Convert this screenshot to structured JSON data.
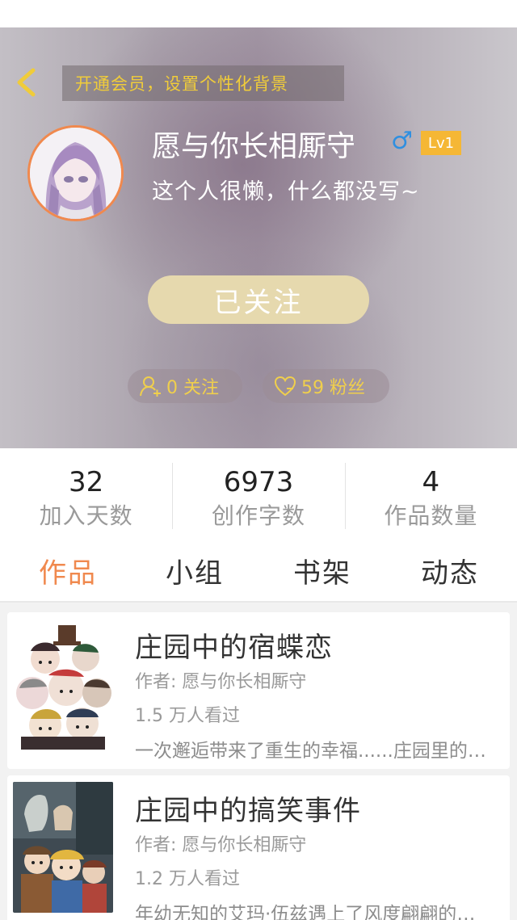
{
  "header": {
    "vip_banner": "开通会员，设置个性化背景",
    "username": "愿与你长相厮守",
    "gender_symbol": "♂",
    "level": "Lv1",
    "bio": "这个人很懒，什么都没写~",
    "follow_button": "已关注",
    "following_text": "0 关注",
    "fans_text": "59 粉丝"
  },
  "stats": [
    {
      "value": "32",
      "label": "加入天数"
    },
    {
      "value": "6973",
      "label": "创作字数"
    },
    {
      "value": "4",
      "label": "作品数量"
    }
  ],
  "tabs": [
    "作品",
    "小组",
    "书架",
    "动态"
  ],
  "works": [
    {
      "title": "庄园中的宿蝶恋",
      "author": "作者: 愿与你长相厮守",
      "views": "1.5 万人看过",
      "description": "一次邂逅带来了重生的幸福......庄园里的故事"
    },
    {
      "title": "庄园中的搞笑事件",
      "author": "作者: 愿与你长相厮守",
      "views": "1.2 万人看过",
      "description": "年幼无知的艾玛·伍兹遇上了风度翩翩的绅士"
    }
  ],
  "colors": {
    "accent": "#f0894e",
    "gold": "#f0cc3a",
    "follow_button": "#e6d9ae",
    "level_badge": "#f5b735",
    "gender": "#2f8fe0"
  },
  "icons": {
    "back": "chevron-left-icon",
    "following": "user-add-icon",
    "fans": "heart-icon"
  }
}
